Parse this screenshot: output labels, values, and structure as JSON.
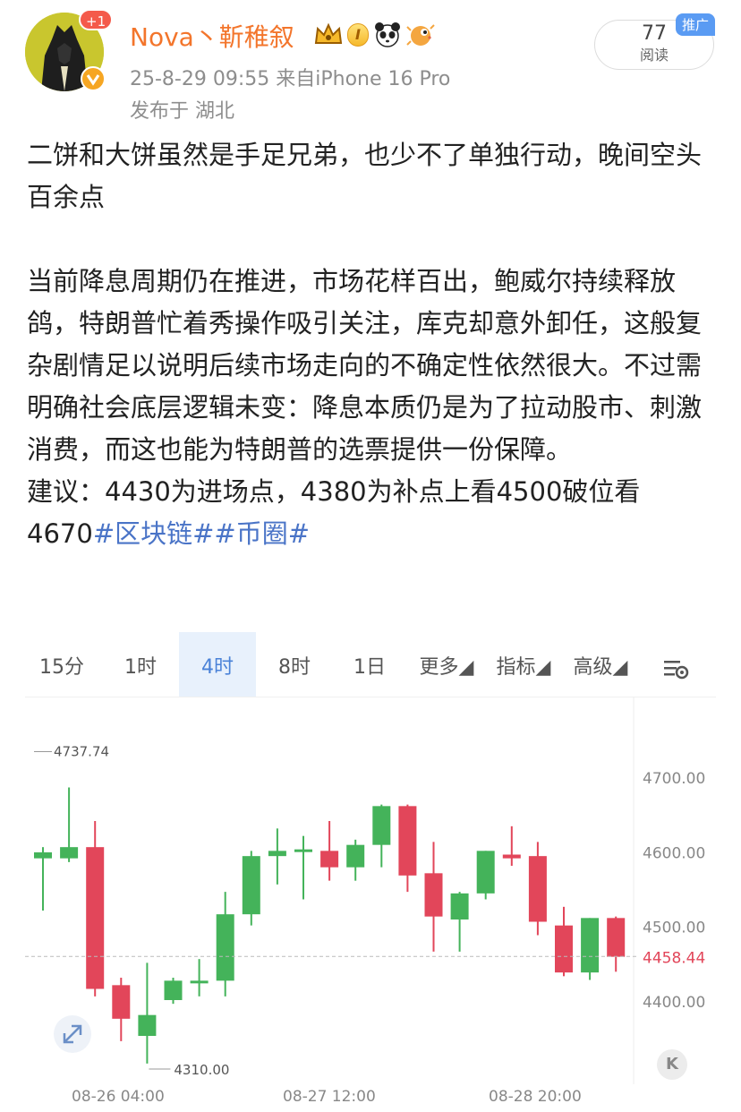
{
  "header": {
    "avatar_badge": "+1",
    "username": "Nova丶靳稚叙",
    "level_badge": "I",
    "timestamp_source": "25-8-29 09:55  来自iPhone 16 Pro",
    "location": "发布于 湖北",
    "read_count": "77",
    "read_label": "阅读",
    "promo_tag": "推广",
    "icons": [
      "crown-icon",
      "level-badge",
      "panda-icon",
      "pufferfish-icon",
      "verified-icon"
    ]
  },
  "post": {
    "para1": "二饼和大饼虽然是手足兄弟，也少不了单独行动，晚间空头百余点",
    "para2": "当前降息周期仍在推进，市场花样百出，鲍威尔持续释放鸽，特朗普忙着秀操作吸引关注，库克却意外卸任，这般复杂剧情足以说明后续市场走向的不确定性依然很大。不过需明确社会底层逻辑未变：降息本质仍是为了拉动股市、刺激消费，而这也能为特朗普的选票提供一份保障。",
    "para3_prefix": "建议：4430为进场点，4380为补点上看4500破位看4670",
    "hashtag1": "#区块链#",
    "hashtag2": "#币圈#"
  },
  "chart_tabs": {
    "items": [
      "15分",
      "1时",
      "4时",
      "8时",
      "1日",
      "更多◢",
      "指标◢",
      "高级◢"
    ],
    "active": "4时"
  },
  "chart_data": {
    "type": "candlestick",
    "interval": "4时",
    "x_ticks": [
      "08-26 04:00",
      "08-27 12:00",
      "08-28 20:00"
    ],
    "y_ticks": [
      4700,
      4600,
      4500,
      4400
    ],
    "ylim": [
      4290,
      4760
    ],
    "high_label": "4737.74",
    "low_label": "4310.00",
    "last_price": "4458.44",
    "colors": {
      "up": "#44b35a",
      "down": "#e2465a",
      "last": "#e2465a"
    },
    "candles": [
      {
        "o": 4590,
        "h": 4605,
        "l": 4520,
        "c": 4598
      },
      {
        "o": 4590,
        "h": 4685,
        "l": 4585,
        "c": 4605
      },
      {
        "o": 4605,
        "h": 4640,
        "l": 4405,
        "c": 4415
      },
      {
        "o": 4420,
        "h": 4430,
        "l": 4345,
        "c": 4375
      },
      {
        "o": 4352,
        "h": 4450,
        "l": 4315,
        "c": 4380
      },
      {
        "o": 4400,
        "h": 4430,
        "l": 4395,
        "c": 4426
      },
      {
        "o": 4426,
        "h": 4455,
        "l": 4405,
        "c": 4426
      },
      {
        "o": 4426,
        "h": 4545,
        "l": 4405,
        "c": 4515
      },
      {
        "o": 4515,
        "h": 4600,
        "l": 4500,
        "c": 4593
      },
      {
        "o": 4593,
        "h": 4630,
        "l": 4555,
        "c": 4600
      },
      {
        "o": 4600,
        "h": 4620,
        "l": 4535,
        "c": 4602
      },
      {
        "o": 4600,
        "h": 4640,
        "l": 4560,
        "c": 4578
      },
      {
        "o": 4578,
        "h": 4615,
        "l": 4560,
        "c": 4608
      },
      {
        "o": 4608,
        "h": 4662,
        "l": 4578,
        "c": 4660
      },
      {
        "o": 4660,
        "h": 4662,
        "l": 4545,
        "c": 4567
      },
      {
        "o": 4570,
        "h": 4612,
        "l": 4465,
        "c": 4512
      },
      {
        "o": 4508,
        "h": 4545,
        "l": 4465,
        "c": 4543
      },
      {
        "o": 4543,
        "h": 4600,
        "l": 4535,
        "c": 4600
      },
      {
        "o": 4595,
        "h": 4633,
        "l": 4580,
        "c": 4590
      },
      {
        "o": 4593,
        "h": 4612,
        "l": 4487,
        "c": 4505
      },
      {
        "o": 4500,
        "h": 4525,
        "l": 4432,
        "c": 4437
      },
      {
        "o": 4437,
        "h": 4510,
        "l": 4427,
        "c": 4510
      },
      {
        "o": 4510,
        "h": 4512,
        "l": 4438,
        "c": 4458
      }
    ]
  }
}
